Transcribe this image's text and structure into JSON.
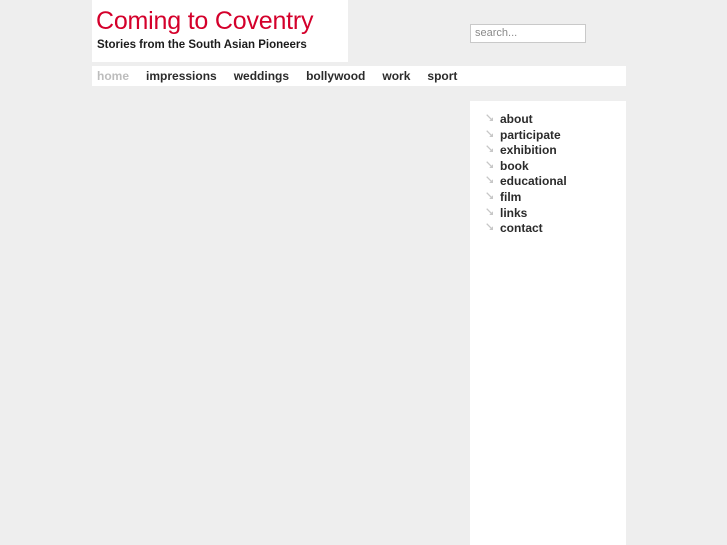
{
  "site": {
    "title": "Coming to Coventry",
    "subtitle": "Stories from the South Asian Pioneers",
    "title_color": "#d4002b",
    "page_background": "#eeeeee",
    "panel_background": "#ffffff"
  },
  "search": {
    "placeholder": "search...",
    "value": ""
  },
  "nav": {
    "items": [
      {
        "label": "home",
        "current": true
      },
      {
        "label": "impressions",
        "current": false
      },
      {
        "label": "weddings",
        "current": false
      },
      {
        "label": "bollywood",
        "current": false
      },
      {
        "label": "work",
        "current": false
      },
      {
        "label": "sport",
        "current": false
      }
    ]
  },
  "sidebar": {
    "bullet_icon": "arrow-down-right-icon",
    "bullet_color": "#c7c7c7",
    "items": [
      {
        "label": "about"
      },
      {
        "label": "participate"
      },
      {
        "label": "exhibition"
      },
      {
        "label": "book"
      },
      {
        "label": "educational"
      },
      {
        "label": "film"
      },
      {
        "label": "links"
      },
      {
        "label": "contact"
      }
    ]
  }
}
